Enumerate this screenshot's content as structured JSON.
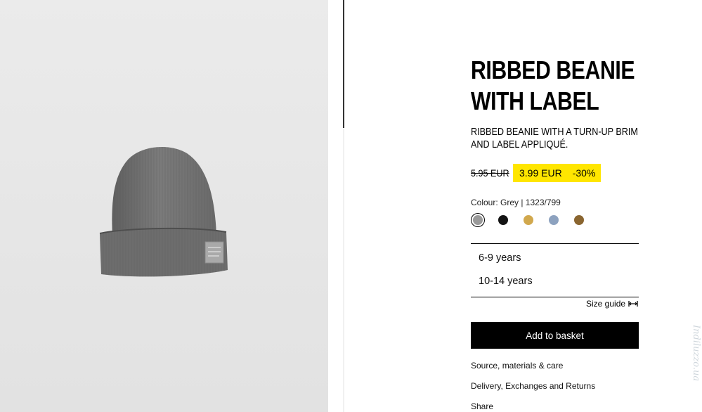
{
  "product": {
    "title_line1": "RIBBED BEANIE",
    "title_line2": "WITH LABEL",
    "description_line1": "RIBBED BEANIE WITH A TURN-UP BRIM",
    "description_line2": "AND LABEL APPLIQUÉ.",
    "old_price": "5.95 EUR",
    "new_price": "3.99 EUR",
    "discount": "-30%",
    "colour_text": "Colour: Grey | 1323/799"
  },
  "swatches": [
    {
      "name": "Grey",
      "color": "#9a9a9a",
      "selected": true
    },
    {
      "name": "Black",
      "color": "#141414",
      "selected": false
    },
    {
      "name": "Mustard",
      "color": "#d1a84d",
      "selected": false
    },
    {
      "name": "Blue grey",
      "color": "#8da2bf",
      "selected": false
    },
    {
      "name": "Brown",
      "color": "#8a6530",
      "selected": false
    }
  ],
  "sizes": [
    "6-9 years",
    "10-14 years"
  ],
  "size_guide_label": "Size guide",
  "add_to_basket_label": "Add to basket",
  "links": {
    "source": "Source, materials & care",
    "delivery": "Delivery, Exchanges and Returns",
    "share": "Share"
  },
  "colors": {
    "sale_highlight": "#ffe600",
    "button_bg": "#000000"
  },
  "watermark": "Indiluzzo.ua"
}
